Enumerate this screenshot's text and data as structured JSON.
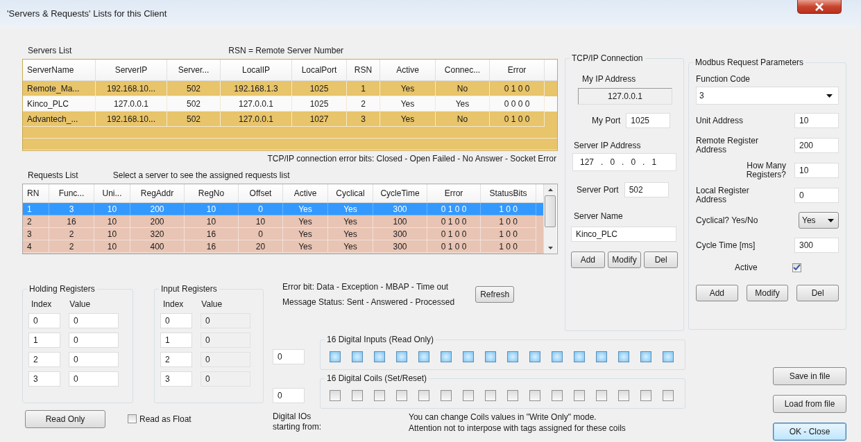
{
  "window": {
    "title": "'Servers & Requests' Lists for this Client"
  },
  "servers": {
    "label": "Servers List",
    "note": "RSN = Remote Server Number",
    "columns": [
      "ServerName",
      "ServerIP",
      "Server...",
      "LocalIP",
      "LocalPort",
      "RSN",
      "Active",
      "Connec...",
      "Error"
    ],
    "rows": [
      {
        "cells": [
          "Remote_Ma...",
          "192.168.10...",
          "502",
          "192.168.1.3",
          "1025",
          "1",
          "Yes",
          "No",
          "0 1 0 0"
        ],
        "highlighted": true
      },
      {
        "cells": [
          "Kinco_PLC",
          "127.0.0.1",
          "502",
          "127.0.0.1",
          "1025",
          "2",
          "Yes",
          "Yes",
          "0 0 0 0"
        ],
        "highlighted": false
      },
      {
        "cells": [
          "Advantech_...",
          "192.168.10...",
          "502",
          "127.0.0.1",
          "1027",
          "3",
          "Yes",
          "No",
          "0 1 0 0"
        ],
        "highlighted": true
      }
    ],
    "error_note": "TCP/IP connection error bits: Closed - Open Failed - No Answer - Socket Error"
  },
  "requests": {
    "label": "Requests List",
    "note": "Select a server to see the assigned requests list",
    "columns": [
      "RN",
      "Func...",
      "Uni...",
      "RegAddr",
      "RegNo",
      "Offset",
      "Active",
      "Cyclical",
      "CycleTime",
      "Error",
      "StatusBits"
    ],
    "rows": [
      {
        "cells": [
          "1",
          "3",
          "10",
          "200",
          "10",
          "0",
          "Yes",
          "Yes",
          "300",
          "0 1 0 0",
          "1 0 0"
        ],
        "selected": true
      },
      {
        "cells": [
          "2",
          "16",
          "10",
          "200",
          "10",
          "10",
          "Yes",
          "Yes",
          "100",
          "0 1 0 0",
          "1 0 0"
        ],
        "selected": false
      },
      {
        "cells": [
          "3",
          "2",
          "10",
          "320",
          "16",
          "0",
          "Yes",
          "Yes",
          "300",
          "0 1 0 0",
          "1 0 0"
        ],
        "selected": false
      },
      {
        "cells": [
          "4",
          "2",
          "10",
          "400",
          "16",
          "20",
          "Yes",
          "Yes",
          "300",
          "0 1 0 0",
          "1 0 0"
        ],
        "selected": false
      }
    ]
  },
  "status_notes": [
    "Error bit:  Data - Exception - MBAP - Time out",
    "Message Status:  Sent - Answered - Processed"
  ],
  "refresh_button": "Refresh",
  "tcp": {
    "title": "TCP/IP Connection",
    "my_ip_label": "My IP Address",
    "my_ip": "127.0.0.1",
    "my_port_label": "My Port",
    "my_port": "1025",
    "server_ip_label": "Server IP Address",
    "server_ip": [
      "127",
      "0",
      "0",
      "1"
    ],
    "ip_separator": ".",
    "server_port_label": "Server Port",
    "server_port": "502",
    "server_name_label": "Server Name",
    "server_name": "Kinco_PLC",
    "buttons": [
      "Add",
      "Modify",
      "Del"
    ]
  },
  "modbus": {
    "title": "Modbus Request Parameters",
    "function_code_label": "Function Code",
    "function_code": "3",
    "fields": [
      {
        "label": "Unit Address",
        "value": "10"
      },
      {
        "label": "Remote Register Address",
        "value": "200"
      },
      {
        "label": "How Many Registers?",
        "value": "10"
      },
      {
        "label": "Local Register Address",
        "value": "0"
      }
    ],
    "cyclical_label": "Cyclical? Yes/No",
    "cyclical": "Yes",
    "cycle_time_label": "Cycle Time [ms]",
    "cycle_time": "300",
    "active_label": "Active",
    "active": true,
    "buttons": [
      "Add",
      "Modify",
      "Del"
    ]
  },
  "holding": {
    "title": "Holding Registers",
    "columns": [
      "Index",
      "Value"
    ],
    "rows": [
      [
        "0",
        "0"
      ],
      [
        "1",
        "0"
      ],
      [
        "2",
        "0"
      ],
      [
        "3",
        "0"
      ]
    ]
  },
  "input": {
    "title": "Input Registers",
    "columns": [
      "Index",
      "Value"
    ],
    "rows": [
      [
        "0",
        "0"
      ],
      [
        "1",
        "0"
      ],
      [
        "2",
        "0"
      ],
      [
        "3",
        "0"
      ]
    ]
  },
  "read_only_button": "Read Only",
  "read_as_float": {
    "label": "Read as Float",
    "checked": false
  },
  "digital": {
    "inputs_title": "16 Digital Inputs (Read Only)",
    "inputs_start": "0",
    "inputs": [
      {
        "checked": false
      },
      {
        "checked": false
      },
      {
        "checked": false
      },
      {
        "checked": false
      },
      {
        "checked": false
      },
      {
        "checked": false
      },
      {
        "checked": false
      },
      {
        "checked": false
      },
      {
        "checked": false
      },
      {
        "checked": false
      },
      {
        "checked": false
      },
      {
        "checked": false
      },
      {
        "checked": false
      },
      {
        "checked": false
      },
      {
        "checked": false
      },
      {
        "checked": false
      }
    ],
    "coils_title": "16 Digital Coils (Set/Reset)",
    "coils_start": "0",
    "coils": [
      {
        "checked": false
      },
      {
        "checked": false
      },
      {
        "checked": false
      },
      {
        "checked": false
      },
      {
        "checked": false
      },
      {
        "checked": false
      },
      {
        "checked": false
      },
      {
        "checked": false
      },
      {
        "checked": false
      },
      {
        "checked": false
      },
      {
        "checked": false
      },
      {
        "checked": false
      },
      {
        "checked": false
      },
      {
        "checked": false
      },
      {
        "checked": false
      },
      {
        "checked": false
      }
    ],
    "start_label": "Digital IOs starting  from:",
    "coil_notes": [
      "You can change Coils values in \"Write Only\" mode.",
      "Attention not to interpose with tags assigned for these coils"
    ]
  },
  "file_buttons": [
    {
      "label": "Save in file",
      "default": false
    },
    {
      "label": "Load from file",
      "default": false
    },
    {
      "label": "OK - Close",
      "default": true
    }
  ]
}
